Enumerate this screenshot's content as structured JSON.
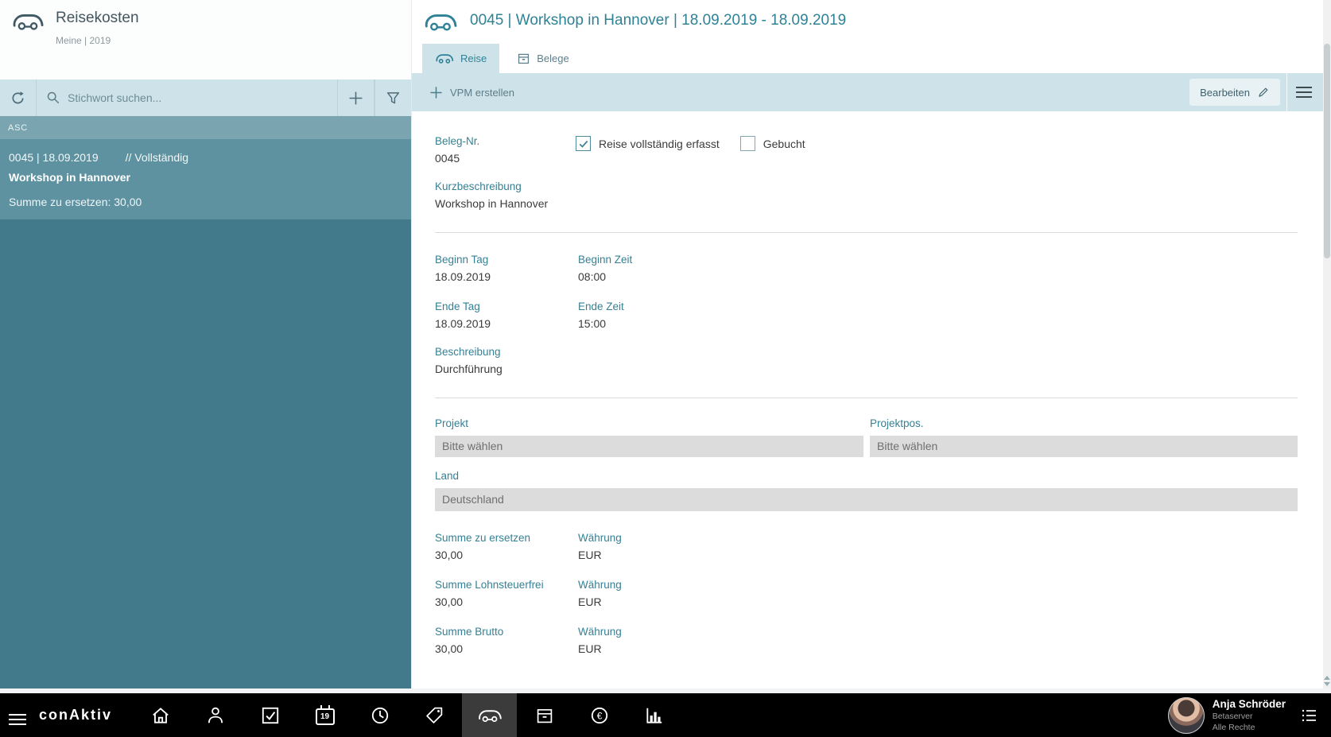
{
  "colors": {
    "accent_teal": "#2f8296",
    "sidebar_dark": "#437a8b",
    "sidebar_selected": "#5e92a1",
    "sort_bar": "#7aa4b0",
    "panel_light": "#cde3e9",
    "input_gray": "#dcdcdc",
    "bottombar": "#000000"
  },
  "sidebar": {
    "title": "Reisekosten",
    "subtitle": "Meine | 2019",
    "search": {
      "placeholder": "Stichwort suchen..."
    },
    "sort_label": "ASC",
    "items": [
      {
        "id_date": "0045 | 18.09.2019",
        "status": "// Vollständig",
        "title": "Workshop in Hannover",
        "summary": "Summe zu ersetzen: 30,00"
      }
    ]
  },
  "main": {
    "title": "0045 | Workshop in Hannover | 18.09.2019 - 18.09.2019",
    "tabs": [
      {
        "label": "Reise",
        "active": true
      },
      {
        "label": "Belege",
        "active": false
      }
    ],
    "toolbar": {
      "create_label": "VPM erstellen",
      "edit_label": "Bearbeiten"
    },
    "form": {
      "beleg_nr": {
        "label": "Beleg-Nr.",
        "value": "0045"
      },
      "complete_checkbox": {
        "label": "Reise vollständig erfasst",
        "checked": true
      },
      "booked_checkbox": {
        "label": "Gebucht",
        "checked": false
      },
      "kurzbeschreibung": {
        "label": "Kurzbeschreibung",
        "value": "Workshop in Hannover"
      },
      "beginn_tag": {
        "label": "Beginn Tag",
        "value": "18.09.2019"
      },
      "beginn_zeit": {
        "label": "Beginn Zeit",
        "value": "08:00"
      },
      "ende_tag": {
        "label": "Ende Tag",
        "value": "18.09.2019"
      },
      "ende_zeit": {
        "label": "Ende Zeit",
        "value": "15:00"
      },
      "beschreibung": {
        "label": "Beschreibung",
        "value": "Durchführung"
      },
      "projekt": {
        "label": "Projekt",
        "value": "Bitte wählen"
      },
      "projektpos": {
        "label": "Projektpos.",
        "value": "Bitte wählen"
      },
      "land": {
        "label": "Land",
        "value": "Deutschland"
      },
      "summe_zu_ersetzen": {
        "label": "Summe zu ersetzen",
        "value": "30,00"
      },
      "summe_lohnsteuerfrei": {
        "label": "Summe Lohnsteuerfrei",
        "value": "30,00"
      },
      "summe_brutto": {
        "label": "Summe Brutto",
        "value": "30,00"
      },
      "waehrung": {
        "label": "Währung",
        "value": "EUR"
      }
    }
  },
  "bottombar": {
    "logo": "conAktiv",
    "calendar_day": "19",
    "euro_glyph": "€",
    "user": {
      "name": "Anja Schröder",
      "server": "Betaserver",
      "rights": "Alle Rechte"
    }
  }
}
